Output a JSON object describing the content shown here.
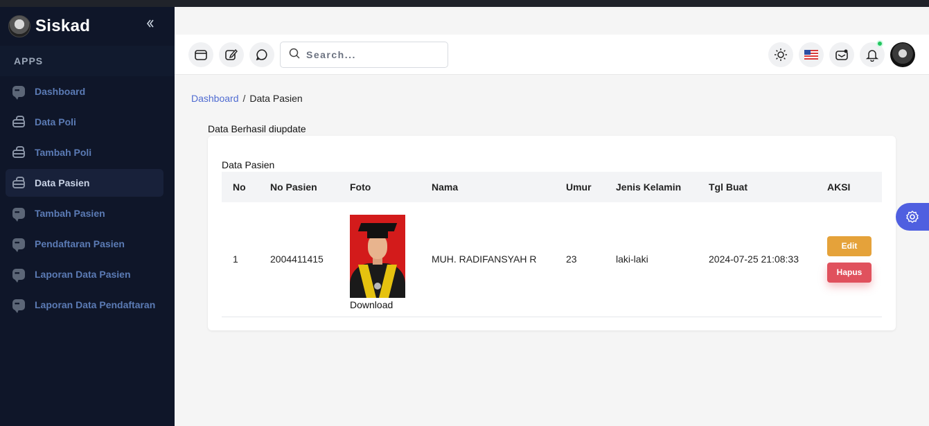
{
  "app": {
    "name": "Siskad"
  },
  "sidebar": {
    "section_label": "APPS",
    "items": [
      {
        "label": "Dashboard",
        "icon": "chat-icon",
        "active": false
      },
      {
        "label": "Data Poli",
        "icon": "shopping-bag-icon",
        "active": false
      },
      {
        "label": "Tambah Poli",
        "icon": "shopping-bag-icon",
        "active": false
      },
      {
        "label": "Data Pasien",
        "icon": "shopping-bag-icon",
        "active": true
      },
      {
        "label": "Tambah Pasien",
        "icon": "chat-icon",
        "active": false
      },
      {
        "label": "Pendaftaran Pasien",
        "icon": "chat-icon",
        "active": false
      },
      {
        "label": "Laporan Data Pasien",
        "icon": "chat-icon",
        "active": false
      },
      {
        "label": "Laporan Data Pendaftaran",
        "icon": "chat-icon",
        "active": false
      }
    ]
  },
  "header": {
    "search_placeholder": "Search..."
  },
  "breadcrumb": {
    "parent": "Dashboard",
    "separator": "/",
    "current": "Data Pasien"
  },
  "alert": {
    "message": "Data Berhasil diupdate"
  },
  "table": {
    "title": "Data Pasien",
    "columns": [
      "No",
      "No Pasien",
      "Foto",
      "Nama",
      "Umur",
      "Jenis Kelamin",
      "Tgl Buat",
      "AKSI"
    ],
    "rows": [
      {
        "no": "1",
        "no_pasien": "2004411415",
        "foto_link": "Download",
        "nama": "MUH. RADIFANSYAH R",
        "umur": "23",
        "jenis_kelamin": "laki-laki",
        "tgl_buat": "2024-07-25 21:08:33",
        "edit_label": "Edit",
        "delete_label": "Hapus"
      }
    ]
  },
  "colors": {
    "sidebar_bg": "#0f1629",
    "accent": "#4f5fe0",
    "edit": "#e5a23a",
    "delete": "#e0515d",
    "notify": "#22c55e"
  }
}
